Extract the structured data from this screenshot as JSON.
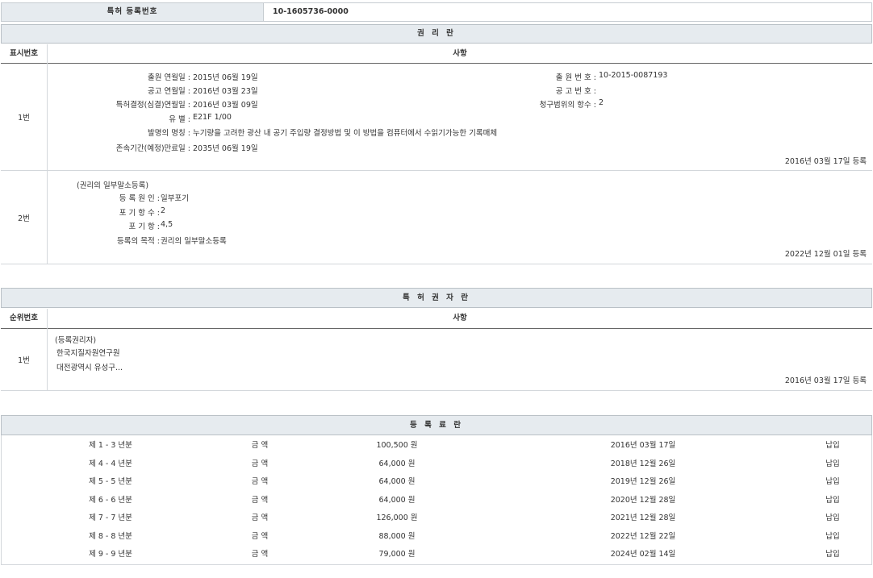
{
  "patent_reg": {
    "label": "특허 등록번호",
    "value": "10-1605736-0000"
  },
  "rights": {
    "title": "권 리 란",
    "col_no": "표시번호",
    "col_matter": "사항",
    "row1": {
      "no": "1번",
      "app_date_label": "출원 연월일 :",
      "app_date": "2015년 06월 19일",
      "app_no_label": "출 원 번 호 :",
      "app_no": "10-2015-0087193",
      "pub_date_label": "공고 연월일 :",
      "pub_date": "2016년 03월 23일",
      "pub_no_label": "공 고 번 호 :",
      "pub_no": "",
      "decision_label": "특허결정(심결)연월일 :",
      "decision_date": "2016년 03월 09일",
      "claims_label": "청구범위의 항수 :",
      "claims": "2",
      "class_label": "유 별 :",
      "class_value": "E21F 1/00",
      "title_label": "발명의 명칭 :",
      "title_value": "누기량을 고려한 광산 내 공기 주입량 결정방법 및 이 방법을 컴퓨터에서 수읽기가능한 기록매체",
      "expiry_label": "존속기간(예정)만료일 :",
      "expiry_value": "2035년 06월 19일",
      "reg_date": "2016년 03월 17일 등록"
    },
    "row2": {
      "no": "2번",
      "heading": "(권리의 일부말소등록)",
      "cause_label": "등 록 원 인 :",
      "cause_value": "일부포기",
      "waiver_count_label": "포 기 항 수 :",
      "waiver_count": "2",
      "waiver_items_label": "포 기 항 :",
      "waiver_items": "4,5",
      "purpose_label": "등록의 목적 :",
      "purpose_value": "권리의 일부말소등록",
      "reg_date": "2022년 12월 01일 등록"
    }
  },
  "holders": {
    "title": "특 허 권 자 란",
    "col_no": "순위번호",
    "col_matter": "사항",
    "row1": {
      "no": "1번",
      "heading": "(등록권리자)",
      "name": "한국지질자원연구원",
      "address": "대전광역시 유성구...",
      "reg_date": "2016년 03월 17일 등록"
    }
  },
  "fees": {
    "title": "등 록 료 란",
    "rows": [
      {
        "period": "제 1 - 3 년분",
        "label": "금 액",
        "amount": "100,500 원",
        "date": "2016년 03월 17일",
        "status": "납입"
      },
      {
        "period": "제 4 - 4 년분",
        "label": "금 액",
        "amount": "64,000 원",
        "date": "2018년 12월 26일",
        "status": "납입"
      },
      {
        "period": "제 5 - 5 년분",
        "label": "금 액",
        "amount": "64,000 원",
        "date": "2019년 12월 26일",
        "status": "납입"
      },
      {
        "period": "제 6 - 6 년분",
        "label": "금 액",
        "amount": "64,000 원",
        "date": "2020년 12월 28일",
        "status": "납입"
      },
      {
        "period": "제 7 - 7 년분",
        "label": "금 액",
        "amount": "126,000 원",
        "date": "2021년 12월 28일",
        "status": "납입"
      },
      {
        "period": "제 8 - 8 년분",
        "label": "금 액",
        "amount": "88,000 원",
        "date": "2022년 12월 22일",
        "status": "납입"
      },
      {
        "period": "제 9 - 9 년분",
        "label": "금 액",
        "amount": "79,000 원",
        "date": "2024년 02월 14일",
        "status": "납입"
      }
    ]
  }
}
